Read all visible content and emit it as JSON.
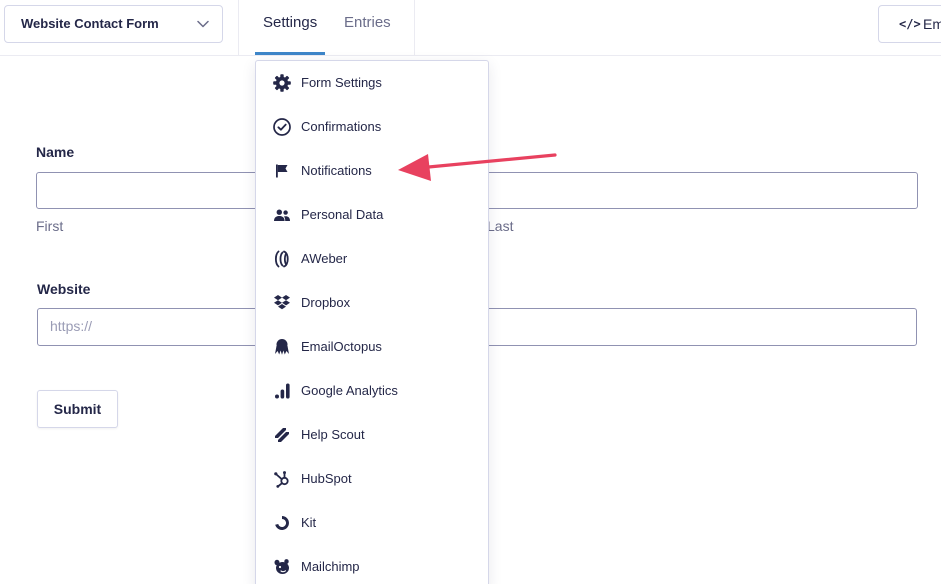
{
  "header": {
    "form_select_value": "Website Contact Form",
    "tabs": [
      {
        "label": "Settings",
        "active": true
      },
      {
        "label": "Entries",
        "active": false
      }
    ],
    "embed_label": "Em"
  },
  "form": {
    "name_label": "Name",
    "name_first_sublabel": "First",
    "name_last_sublabel": "Last",
    "website_label": "Website",
    "website_placeholder": "https://",
    "submit_label": "Submit"
  },
  "settings_menu": {
    "items": [
      {
        "label": "Form Settings",
        "icon": "gear-icon"
      },
      {
        "label": "Confirmations",
        "icon": "check-circle-icon"
      },
      {
        "label": "Notifications",
        "icon": "flag-icon"
      },
      {
        "label": "Personal Data",
        "icon": "users-icon"
      },
      {
        "label": "AWeber",
        "icon": "aweber-icon"
      },
      {
        "label": "Dropbox",
        "icon": "dropbox-icon"
      },
      {
        "label": "EmailOctopus",
        "icon": "octopus-icon"
      },
      {
        "label": "Google Analytics",
        "icon": "analytics-icon"
      },
      {
        "label": "Help Scout",
        "icon": "helpscout-icon"
      },
      {
        "label": "HubSpot",
        "icon": "hubspot-icon"
      },
      {
        "label": "Kit",
        "icon": "kit-icon"
      },
      {
        "label": "Mailchimp",
        "icon": "mailchimp-icon"
      }
    ]
  },
  "annotation": {
    "arrow_color": "#e8415f",
    "points_to": "Notifications"
  },
  "colors": {
    "accent": "#3e86c9",
    "text": "#242748",
    "muted": "#6b6d8a"
  }
}
